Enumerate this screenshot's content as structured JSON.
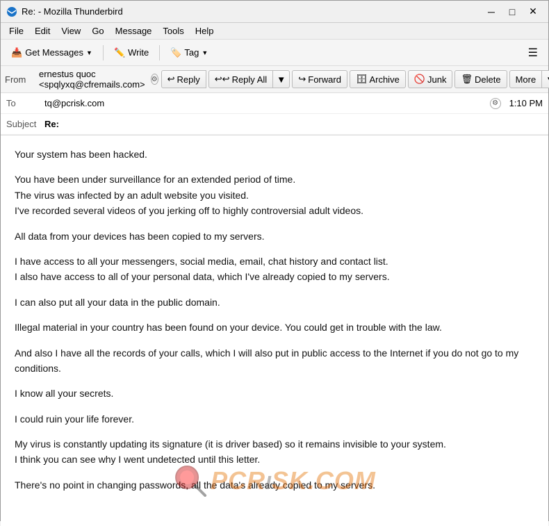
{
  "titlebar": {
    "title": "Re: - Mozilla Thunderbird",
    "icon": "🦅",
    "minimize": "─",
    "maximize": "□",
    "close": "✕"
  },
  "menubar": {
    "items": [
      "File",
      "Edit",
      "View",
      "Go",
      "Message",
      "Tools",
      "Help"
    ]
  },
  "toolbar": {
    "get_messages_label": "Get Messages",
    "write_label": "Write",
    "tag_label": "Tag",
    "hamburger": "☰"
  },
  "header": {
    "from_label": "From",
    "from_value": "ernestus quoc <spqlyxq@cfremails.com>",
    "to_label": "To",
    "to_value": "tq@pcrisk.com",
    "subject_label": "Subject",
    "subject_value": "Re:",
    "time": "1:10 PM"
  },
  "actions": {
    "reply_label": "Reply",
    "reply_all_label": "Reply All",
    "forward_label": "Forward",
    "archive_label": "Archive",
    "junk_label": "Junk",
    "delete_label": "Delete",
    "more_label": "More"
  },
  "body": {
    "paragraphs": [
      "Your system has been hacked.",
      "You have been under surveillance for an extended period of time.\nThe virus was infected by an adult website you visited.\nI've recorded several videos of you jerking off to highly controversial adult videos.",
      "All data from your devices has been copied to my servers.",
      "I have access to all your messengers, social media, email, chat history and contact list.\nI also have access to all of your personal data, which I've already copied to my servers.",
      "I can also put all your data in the public domain.",
      "Illegal material in your country has been found on your device. You could get in trouble with the law.",
      "And also I have all the records of your calls, which I will also put in public access to the Internet if you do not go to my conditions.",
      "I know all your secrets.",
      "I could ruin your life forever.",
      "My virus is constantly updating its signature (it is driver based) so it remains invisible to your system.\nI think you can see why I went undetected until this letter.",
      "There's no point in changing passwords, all the data's already copied to my servers."
    ]
  },
  "watermark": {
    "text": "PCR SK.COM"
  }
}
